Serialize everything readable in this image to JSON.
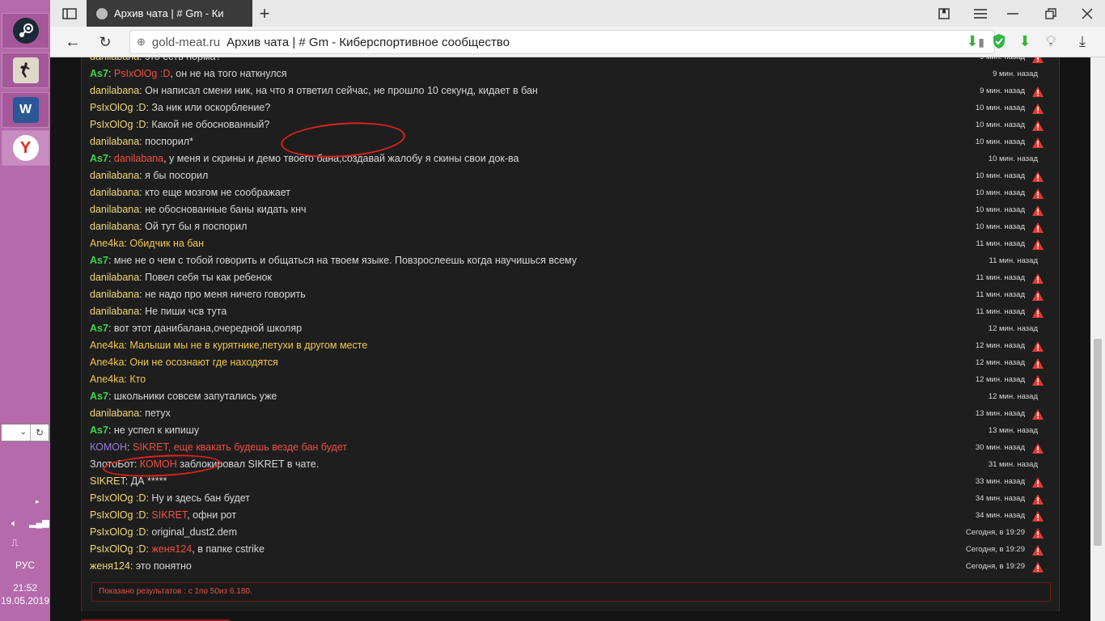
{
  "taskbar": {
    "apps": [
      {
        "name": "steam-icon",
        "label": "S"
      },
      {
        "name": "counter-strike-icon",
        "label": "CS"
      },
      {
        "name": "word-icon",
        "label": "W"
      },
      {
        "name": "yandex-icon",
        "label": "Y"
      }
    ],
    "lang": "РУС",
    "time": "21:52",
    "date": "19.05.2019"
  },
  "browser": {
    "tab_title": "Архив чата | # Gm - Ки",
    "domain": "gold-meat.ru",
    "page_title": "Архив чата | # Gm - Киберспортивное сообщество",
    "new_tab": "+"
  },
  "chat": {
    "messages": [
      {
        "user": "danilabana",
        "ucls": "u-y",
        "mention": "",
        "mcls": "",
        "text": ": это есть норма?",
        "time": "9 мин. назад",
        "flag": true
      },
      {
        "user": "As7",
        "ucls": "u-g",
        "mention": "PsIxOlOg :D",
        "mcls": "u-r",
        "text": ", он не на того наткнулся",
        "time": "9 мин. назад",
        "flag": false
      },
      {
        "user": "danilabana",
        "ucls": "u-y",
        "mention": "",
        "mcls": "",
        "text": ": Он написал смени ник, на что я ответил сейчас, не прошло 10 секунд, кидает в бан",
        "time": "9 мин. назад",
        "flag": true
      },
      {
        "user": "PsIxOlOg :D",
        "ucls": "u-y",
        "mention": "",
        "mcls": "",
        "text": ": За ник или оскорбление?",
        "time": "10 мин. назад",
        "flag": true
      },
      {
        "user": "PsIxOlOg :D",
        "ucls": "u-y",
        "mention": "",
        "mcls": "",
        "text": ": Какой не обоснованный?",
        "time": "10 мин. назад",
        "flag": true
      },
      {
        "user": "danilabana",
        "ucls": "u-y",
        "mention": "",
        "mcls": "",
        "text": ": поспорил*",
        "time": "10 мин. назад",
        "flag": true
      },
      {
        "user": "As7",
        "ucls": "u-g",
        "mention": "danilabana",
        "mcls": "u-r",
        "text": ", у меня и скрины и демо твоего бана,создавай жалобу я скины свои док-ва",
        "time": "10 мин. назад",
        "flag": false
      },
      {
        "user": "danilabana",
        "ucls": "u-y",
        "mention": "",
        "mcls": "",
        "text": ": я бы посорил",
        "time": "10 мин. назад",
        "flag": true
      },
      {
        "user": "danilabana",
        "ucls": "u-y",
        "mention": "",
        "mcls": "",
        "text": ": кто еще мозгом не соображает",
        "time": "10 мин. назад",
        "flag": true
      },
      {
        "user": "danilabana",
        "ucls": "u-y",
        "mention": "",
        "mcls": "",
        "text": ": не обоснованные баны кидать кнч",
        "time": "10 мин. назад",
        "flag": true
      },
      {
        "user": "danilabana",
        "ucls": "u-y",
        "mention": "",
        "mcls": "",
        "text": ": Ой тут бы я поспорил",
        "time": "10 мин. назад",
        "flag": true
      },
      {
        "user": "Ane4ka",
        "ucls": "u-o",
        "mention": "",
        "mcls": "",
        "text": ": Обидчик на бан",
        "time": "11 мин. назад",
        "flag": true,
        "tcls": "u-o"
      },
      {
        "user": "As7",
        "ucls": "u-g",
        "mention": "",
        "mcls": "",
        "text": ": мне не о чем с тобой говорить и общаться на твоем языке. Повзрослеешь когда научишься всему",
        "time": "11 мин. назад",
        "flag": false
      },
      {
        "user": "danilabana",
        "ucls": "u-y",
        "mention": "",
        "mcls": "",
        "text": ": Повел себя ты как ребенок",
        "time": "11 мин. назад",
        "flag": true
      },
      {
        "user": "danilabana",
        "ucls": "u-y",
        "mention": "",
        "mcls": "",
        "text": ": не надо про меня ничего говорить",
        "time": "11 мин. назад",
        "flag": true
      },
      {
        "user": "danilabana",
        "ucls": "u-y",
        "mention": "",
        "mcls": "",
        "text": ": Не пиши чсв тута",
        "time": "11 мин. назад",
        "flag": true
      },
      {
        "user": "As7",
        "ucls": "u-g",
        "mention": "",
        "mcls": "",
        "text": ": вот этот данибалана,очередной школяр",
        "time": "12 мин. назад",
        "flag": false
      },
      {
        "user": "Ane4ka",
        "ucls": "u-o",
        "mention": "",
        "mcls": "",
        "text": ": Малыши мы не в курятнике,петухи в другом месте",
        "time": "12 мин. назад",
        "flag": true,
        "tcls": "u-o"
      },
      {
        "user": "Ane4ka",
        "ucls": "u-o",
        "mention": "",
        "mcls": "",
        "text": ": Они не осознают где находятся",
        "time": "12 мин. назад",
        "flag": true,
        "tcls": "u-o"
      },
      {
        "user": "Ane4ka",
        "ucls": "u-o",
        "mention": "",
        "mcls": "",
        "text": ": Кто",
        "time": "12 мин. назад",
        "flag": true,
        "tcls": "u-o"
      },
      {
        "user": "As7",
        "ucls": "u-g",
        "mention": "",
        "mcls": "",
        "text": ": школьники совсем запутались уже",
        "time": "12 мин. назад",
        "flag": false
      },
      {
        "user": "danilabana",
        "ucls": "u-y",
        "mention": "",
        "mcls": "",
        "text": ": петух",
        "time": "13 мин. назад",
        "flag": true
      },
      {
        "user": "As7",
        "ucls": "u-g",
        "mention": "",
        "mcls": "",
        "text": ": не успел к кипишу",
        "time": "13 мин. назад",
        "flag": false
      },
      {
        "user": "КОМОН",
        "ucls": "u-p",
        "mention": "SIKRET",
        "mcls": "u-r",
        "text": ", еще квакать будешь везде бан будет",
        "time": "30 мин. назад",
        "flag": true,
        "tcls": "u-r"
      },
      {
        "user": "ЗлотоБот",
        "ucls": "",
        "mention": "КОМОН",
        "mcls": "u-r",
        "text": " заблокировал SIKRET в чате.",
        "time": "31 мин. назад",
        "flag": false,
        "sep": ": "
      },
      {
        "user": "SIKRET",
        "ucls": "u-y",
        "mention": "",
        "mcls": "",
        "text": ": ДА *****",
        "time": "33 мин. назад",
        "flag": true
      },
      {
        "user": "PsIxOlOg :D",
        "ucls": "u-y",
        "mention": "",
        "mcls": "",
        "text": ": Ну и здесь бан будет",
        "time": "34 мин. назад",
        "flag": true
      },
      {
        "user": "PsIxOlOg :D",
        "ucls": "u-y",
        "mention": "SIKRET",
        "mcls": "u-r",
        "text": ", офни рот",
        "time": "34 мин. назад",
        "flag": true,
        "sep": ": "
      },
      {
        "user": "PsIxOlOg :D",
        "ucls": "u-y",
        "mention": "",
        "mcls": "",
        "text": ": original_dust2.dem",
        "time": "Сегодня, в 19:29",
        "flag": true
      },
      {
        "user": "PsIxOlOg :D",
        "ucls": "u-y",
        "mention": "женя124",
        "mcls": "u-r",
        "text": ", в папке cstrike",
        "time": "Сегодня, в 19:29",
        "flag": true,
        "sep": ": "
      },
      {
        "user": "женя124",
        "ucls": "u-y",
        "mention": "",
        "mcls": "",
        "text": ": это понятно",
        "time": "Сегодня, в 19:29",
        "flag": true
      }
    ],
    "pager": "Показано результатов : с 1по 50из 6.180."
  }
}
